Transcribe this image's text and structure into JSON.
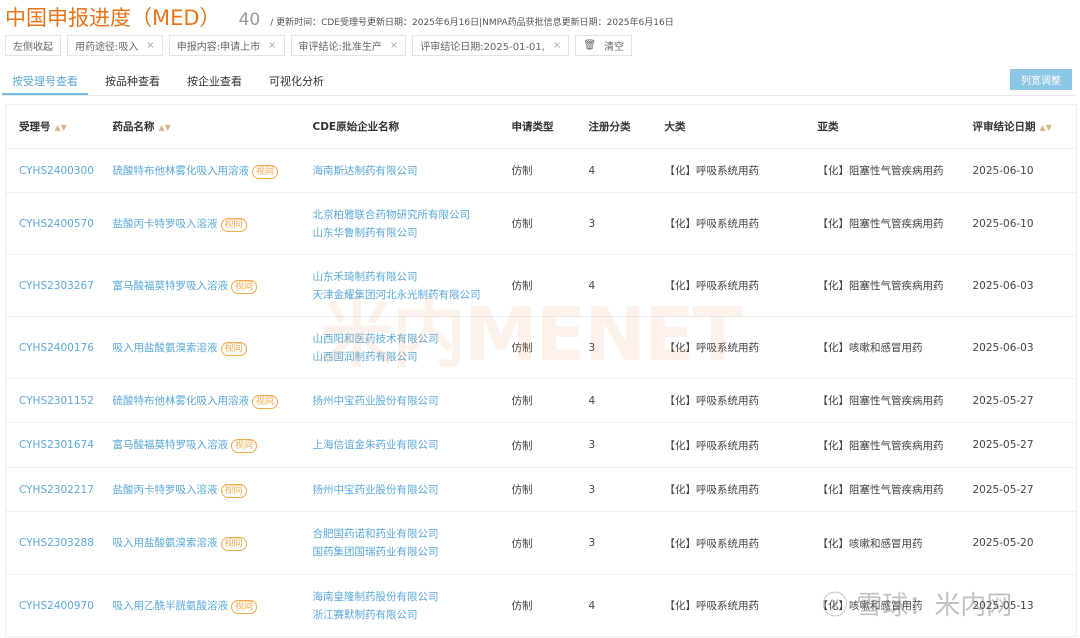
{
  "header": {
    "title": "中国申报进度（MED）",
    "count": "40",
    "update": "/ 更新时间：CDE受理号更新日期：2025年6月16日|NMPA药品获批信息更新日期：2025年6月16日"
  },
  "filters": {
    "collapse": "左侧收起",
    "chips": [
      "用药途径:吸入",
      "申报内容:申请上市",
      "审评结论:批准生产",
      "评审结论日期:2025-01-01,"
    ],
    "clear": "清空"
  },
  "tabs": [
    "按受理号查看",
    "按品种查看",
    "按企业查看",
    "可视化分析"
  ],
  "column_adjust": "列宽调整",
  "columns": [
    "受理号",
    "药品名称",
    "CDE原始企业名称",
    "申请类型",
    "注册分类",
    "大类",
    "亚类",
    "评审结论日期"
  ],
  "tag": "视同",
  "rows": [
    {
      "id": "CYHS2400300",
      "drug": "硫酸特布他林雾化吸入用溶液",
      "companies": [
        "海南斯达制药有限公司"
      ],
      "type": "仿制",
      "cls": "4",
      "cat": "【化】呼吸系统用药",
      "sub": "【化】阻塞性气管疾病用药",
      "date": "2025-06-10"
    },
    {
      "id": "CYHS2400570",
      "drug": "盐酸丙卡特罗吸入溶液",
      "companies": [
        "北京柏雅联合药物研究所有限公司",
        "山东华鲁制药有限公司"
      ],
      "type": "仿制",
      "cls": "3",
      "cat": "【化】呼吸系统用药",
      "sub": "【化】阻塞性气管疾病用药",
      "date": "2025-06-10"
    },
    {
      "id": "CYHS2303267",
      "drug": "富马酸福莫特罗吸入溶液",
      "companies": [
        "山东禾琦制药有限公司",
        "天津金耀集团河北永光制药有限公司"
      ],
      "type": "仿制",
      "cls": "4",
      "cat": "【化】呼吸系统用药",
      "sub": "【化】阻塞性气管疾病用药",
      "date": "2025-06-03"
    },
    {
      "id": "CYHS2400176",
      "drug": "吸入用盐酸氨溴索溶液",
      "companies": [
        "山西阳和医药技术有限公司",
        "山西国润制药有限公司"
      ],
      "type": "仿制",
      "cls": "3",
      "cat": "【化】呼吸系统用药",
      "sub": "【化】咳嗽和感冒用药",
      "date": "2025-06-03"
    },
    {
      "id": "CYHS2301152",
      "drug": "硫酸特布他林雾化吸入用溶液",
      "companies": [
        "扬州中宝药业股份有限公司"
      ],
      "type": "仿制",
      "cls": "4",
      "cat": "【化】呼吸系统用药",
      "sub": "【化】阻塞性气管疾病用药",
      "date": "2025-05-27"
    },
    {
      "id": "CYHS2301674",
      "drug": "富马酸福莫特罗吸入溶液",
      "companies": [
        "上海信谊金朱药业有限公司"
      ],
      "type": "仿制",
      "cls": "3",
      "cat": "【化】呼吸系统用药",
      "sub": "【化】阻塞性气管疾病用药",
      "date": "2025-05-27"
    },
    {
      "id": "CYHS2302217",
      "drug": "盐酸丙卡特罗吸入溶液",
      "companies": [
        "扬州中宝药业股份有限公司"
      ],
      "type": "仿制",
      "cls": "3",
      "cat": "【化】呼吸系统用药",
      "sub": "【化】阻塞性气管疾病用药",
      "date": "2025-05-27"
    },
    {
      "id": "CYHS2303288",
      "drug": "吸入用盐酸氨溴索溶液",
      "companies": [
        "合肥国药诺和药业有限公司",
        "国药集团国瑞药业有限公司"
      ],
      "type": "仿制",
      "cls": "3",
      "cat": "【化】呼吸系统用药",
      "sub": "【化】咳嗽和感冒用药",
      "date": "2025-05-20"
    },
    {
      "id": "CYHS2400970",
      "drug": "吸入用乙酰半胱氨酸溶液",
      "companies": [
        "海南皇隆制药股份有限公司",
        "浙江赛默制药有限公司"
      ],
      "type": "仿制",
      "cls": "4",
      "cat": "【化】呼吸系统用药",
      "sub": "【化】咳嗽和感冒用药",
      "date": "2025-05-13"
    }
  ],
  "watermarks": [
    "米内MENET",
    "雪球：米内网"
  ]
}
